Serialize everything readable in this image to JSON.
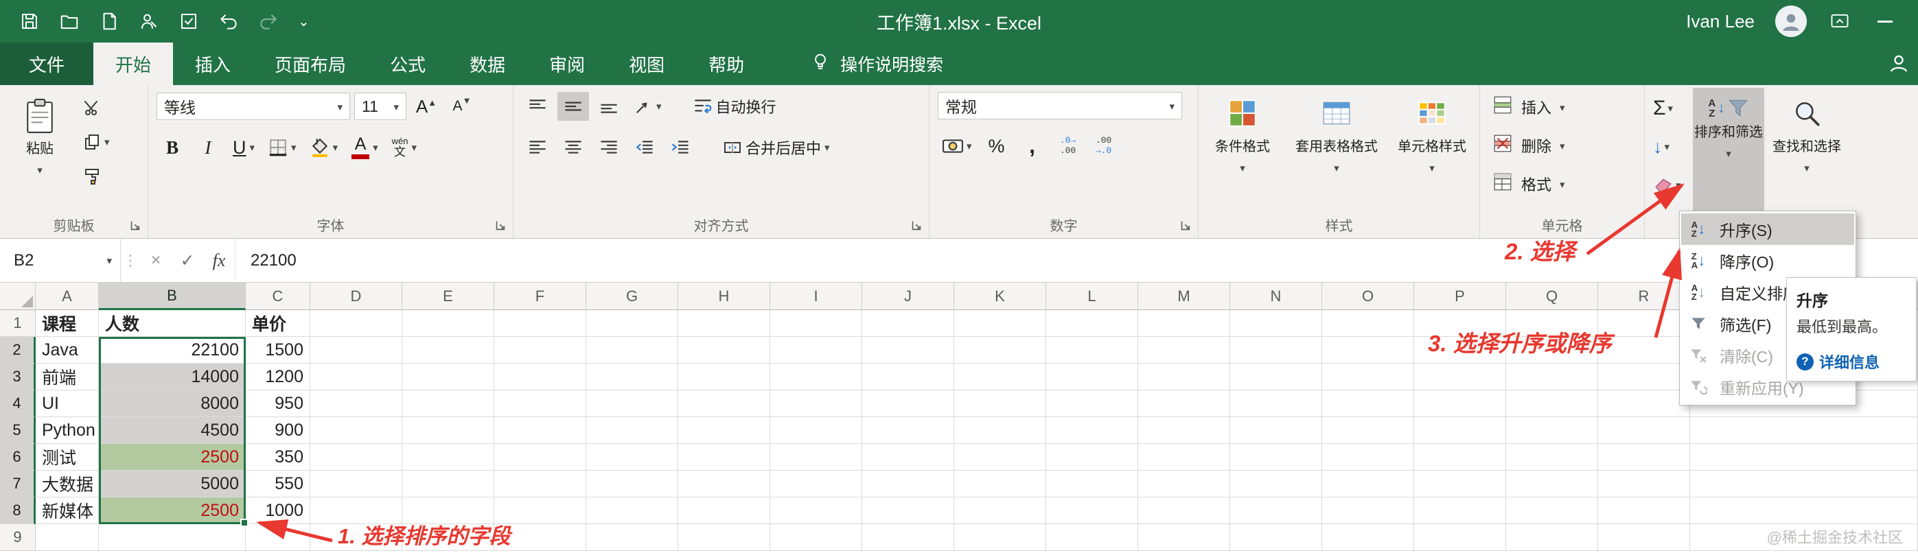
{
  "title_bar": {
    "title": "工作簿1.xlsx -  Excel",
    "user_name": "Ivan Lee",
    "qat_icons": [
      "save-icon",
      "open-icon",
      "new-document-icon",
      "signature-icon",
      "task-check-icon",
      "undo-icon",
      "redo-icon",
      "qat-dropdown-icon"
    ],
    "window_icons": [
      "ribbon-display-options-icon",
      "minimize-icon"
    ]
  },
  "tabs": [
    {
      "label": "文件",
      "type": "file"
    },
    {
      "label": "开始",
      "active": true
    },
    {
      "label": "插入"
    },
    {
      "label": "页面布局"
    },
    {
      "label": "公式"
    },
    {
      "label": "数据"
    },
    {
      "label": "审阅"
    },
    {
      "label": "视图"
    },
    {
      "label": "帮助"
    }
  ],
  "tell_me": "操作说明搜索",
  "ribbon": {
    "clipboard": {
      "label": "剪贴板",
      "paste": "粘贴"
    },
    "font": {
      "label": "字体",
      "font_name": "等线",
      "font_size": "11",
      "bold": "B",
      "italic": "I",
      "underline": "U",
      "color_letter": "A",
      "pinyin_top": "wén",
      "pinyin_bottom": "文"
    },
    "alignment": {
      "label": "对齐方式",
      "wrap": "自动换行",
      "merge": "合并后居中"
    },
    "number": {
      "label": "数字",
      "format": "常规",
      "percent": "%",
      "comma": ","
    },
    "styles": {
      "label": "样式",
      "conditional": "条件格式",
      "format_table": "套用表格格式",
      "cell_styles": "单元格样式"
    },
    "cells": {
      "label": "单元格",
      "insert": "插入",
      "delete": "删除",
      "format": "格式"
    },
    "editing": {
      "autosum": "Σ",
      "sort_filter": "排序和筛选",
      "find_select": "查找和选择"
    }
  },
  "formula_bar": {
    "name_box": "B2",
    "cancel": "×",
    "enter": "✓",
    "fx": "fx",
    "value": "22100"
  },
  "sheet": {
    "columns": [
      "A",
      "B",
      "C",
      "D",
      "E",
      "F",
      "G",
      "H",
      "I",
      "J",
      "K",
      "L",
      "M",
      "N",
      "O",
      "P",
      "Q",
      "R"
    ],
    "selected_col": "B",
    "selected_range": "B2:B8",
    "rows": [
      {
        "n": "1",
        "A": "课程",
        "B": "人数",
        "C": "单价"
      },
      {
        "n": "2",
        "A": "Java",
        "B": "22100",
        "C": "1500"
      },
      {
        "n": "3",
        "A": "前端",
        "B": "14000",
        "C": "1200"
      },
      {
        "n": "4",
        "A": "UI",
        "B": "8000",
        "C": "950"
      },
      {
        "n": "5",
        "A": "Python",
        "B": "4500",
        "C": "900"
      },
      {
        "n": "6",
        "A": "测试",
        "B": "2500",
        "C": "350",
        "b_highlight": true
      },
      {
        "n": "7",
        "A": "大数据",
        "B": "5000",
        "C": "550"
      },
      {
        "n": "8",
        "A": "新媒体",
        "B": "2500",
        "C": "1000",
        "b_highlight": true
      },
      {
        "n": "9",
        "A": "",
        "B": "",
        "C": ""
      }
    ]
  },
  "sort_menu": {
    "items": [
      {
        "label": "升序(S)",
        "name": "sort-ascending",
        "icon": "az-ascending-icon",
        "highlighted": true
      },
      {
        "label": "降序(O)",
        "name": "sort-descending",
        "icon": "za-descending-icon"
      },
      {
        "label": "自定义排序(U)...",
        "name": "custom-sort",
        "icon": "custom-sort-icon"
      },
      {
        "label": "筛选(F)",
        "name": "filter",
        "icon": "filter-icon"
      },
      {
        "label": "清除(C)",
        "name": "clear-filter",
        "icon": "clear-filter-icon",
        "disabled": true
      },
      {
        "label": "重新应用(Y)",
        "name": "reapply-filter",
        "icon": "reapply-icon",
        "disabled": true
      }
    ]
  },
  "tooltip": {
    "title": "升序",
    "body": "最低到最高。",
    "link": "详细信息"
  },
  "annotations": {
    "step1": "1. 选择排序的字段",
    "step2": "2. 选择",
    "step3": "3. 选择升序或降序",
    "color": "#e8382f"
  },
  "watermark": "@稀土掘金技术社区",
  "colors": {
    "excel_green": "#217346",
    "selection_border": "#217346",
    "bad_cell_bg": "#b3c9a0",
    "bad_cell_text": "#c01010"
  }
}
